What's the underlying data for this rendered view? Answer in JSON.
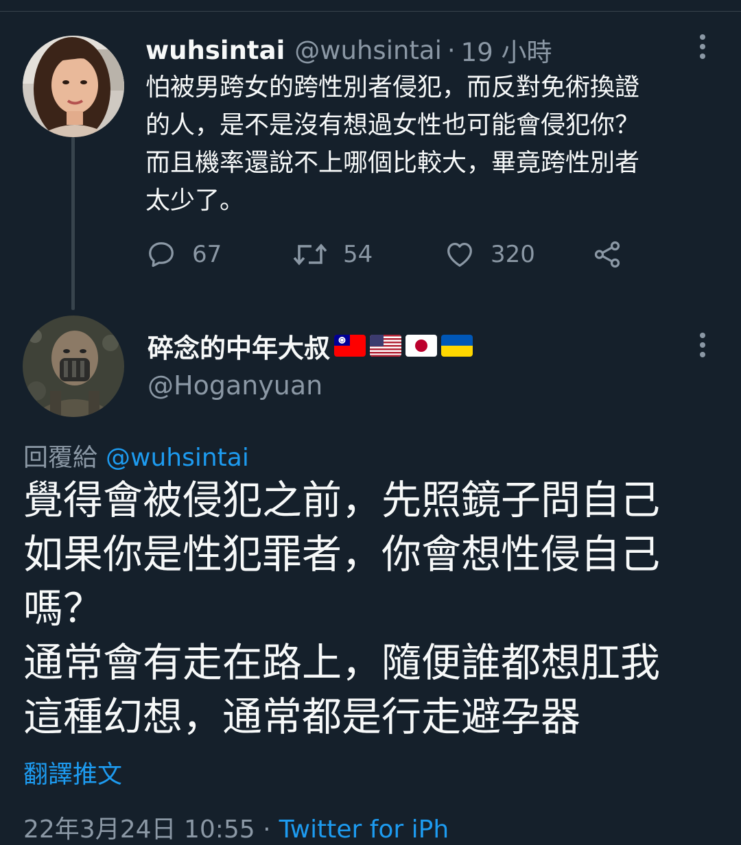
{
  "tweet1": {
    "name": "wuhsintai",
    "handle": "@wuhsintai",
    "separator": "·",
    "time": "19 小時",
    "lines": [
      "怕被男跨女的跨性別者侵犯，而反對免術換證",
      "的人，是不是沒有想過女性也可能會侵犯你？",
      "而且機率還說不上哪個比較大，畢竟跨性別者",
      "太少了。"
    ],
    "replies": "67",
    "retweets": "54",
    "likes": "320",
    "icons": {
      "reply": "reply-icon",
      "retweet": "retweet-icon",
      "like": "heart-icon",
      "share": "share-icon",
      "more": "more-icon"
    }
  },
  "tweet2": {
    "name": "碎念的中年大叔",
    "flags": [
      "taiwan-flag",
      "usa-flag",
      "japan-flag",
      "ukraine-flag"
    ],
    "handle": "@Hoganyuan",
    "replying_label": "回覆給",
    "replying_to": "@wuhsintai",
    "lines": [
      "覺得會被侵犯之前，先照鏡子問自己",
      "如果你是性犯罪者，你會想性侵自己",
      "嗎？",
      "通常會有走在路上，隨便誰都想肛我",
      "這種幻想，通常都是行走避孕器"
    ],
    "translate_label": "翻譯推文",
    "meta_partial": "22年3月24日 10:55 ·",
    "source_partial": "Twitter for iPh"
  },
  "colors": {
    "background": "#15202b",
    "text": "#f7f9f9",
    "secondary": "#8b98a5",
    "accent": "#1d9bf0",
    "divider": "#38444d"
  }
}
